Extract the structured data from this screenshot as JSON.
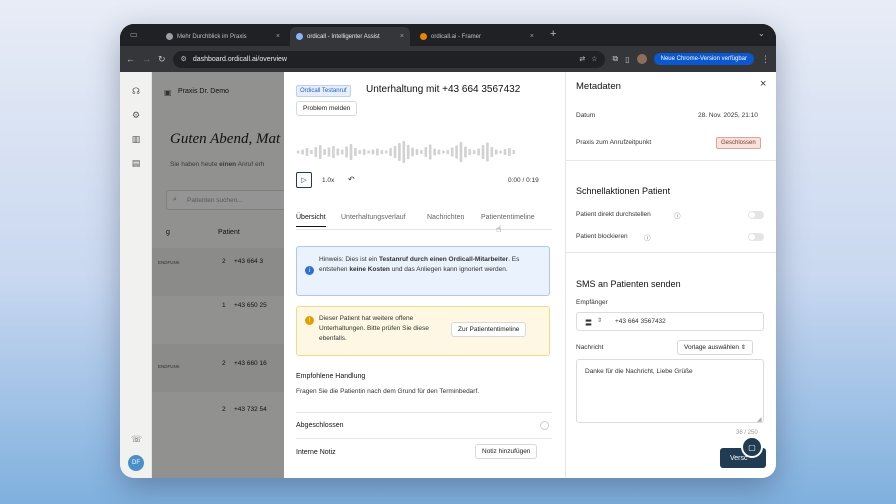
{
  "browser": {
    "tabs": [
      {
        "label": "Mehr Durchblick im Praxis",
        "active": false
      },
      {
        "label": "ordicall - Intelligenter Assist",
        "active": true
      },
      {
        "label": "ordicall.ai - Framer",
        "active": false
      }
    ],
    "new_tab": "+",
    "url": "dashboard.ordicall.ai/overview",
    "update_label": "Neue Chrome-Version verfügbar"
  },
  "background": {
    "practice": "Praxis Dr. Demo",
    "greeting": "Guten Abend, Mat",
    "subline_prefix": "Sie haben heute",
    "subline_bold": "einen",
    "subline_suffix": "Anruf erh",
    "search_placeholder": "Patienten suchen...",
    "col_a": "g",
    "col_b": "Patient",
    "rows": [
      {
        "tag": "ENDFUNK",
        "num": "2",
        "phone": "+43 664 3"
      },
      {
        "tag": "",
        "num": "1",
        "phone": "+43 650 25"
      },
      {
        "tag": "ENDFUNK",
        "num": "2",
        "phone": "+43 660 16"
      },
      {
        "tag": "",
        "num": "2",
        "phone": "+43 732 54"
      }
    ],
    "avatar": "DF"
  },
  "call": {
    "badge": "Ordicall Testanruf",
    "title": "Unterhaltung mit +43 664 3567432",
    "report_button": "Problem melden",
    "speed": "1.0x",
    "time": "0:00 / 0:19",
    "tabs": [
      "Übersicht",
      "Unterhaltungsverlauf",
      "Nachrichten",
      "Patiententimeline"
    ],
    "info": {
      "prefix": "Hinweis: Dies ist ein ",
      "bold1": "Testanruf durch einen Ordicall-Mitarbeiter",
      "mid": ". Es entstehen ",
      "bold2": "keine Kosten",
      "suffix": " und das Anliegen kann ignoriert werden."
    },
    "warning": {
      "text": "Dieser Patient hat weitere offene Unterhaltungen. Bitte prüfen Sie diese ebenfalls.",
      "button": "Zur Patiententimeline"
    },
    "recommended_label": "Empfohlene Handlung",
    "recommended_text": "Fragen Sie die Patientin nach dem Grund für den Terminbedarf.",
    "completed_label": "Abgeschlossen",
    "note_label": "Interne Notiz",
    "note_button": "Notiz hinzufügen"
  },
  "meta": {
    "title": "Metadaten",
    "close": "×",
    "date_label": "Datum",
    "date_value": "28. Nov. 2025, 21:10",
    "practice_label": "Praxis zum Anrufzeitpunkt",
    "practice_status": "Geschlossen",
    "quick_title": "Schnellaktionen Patient",
    "forward_label": "Patient direkt durchstellen",
    "block_label": "Patient blockieren",
    "sms_title": "SMS an Patienten senden",
    "recipient_label": "Empfänger",
    "recipient_value": "+43 664 3567432",
    "message_label": "Nachricht",
    "template_button": "Vorlage auswählen",
    "message_text": "Danke für die Nachricht, Liebe Grüße",
    "counter": "36 / 250",
    "send_label": "Versc"
  },
  "colors": {
    "accent": "#1f3c52",
    "info_bg": "#eaf2fd",
    "warn_bg": "#fdf7e3",
    "closed_badge": "#f7e2dc"
  }
}
